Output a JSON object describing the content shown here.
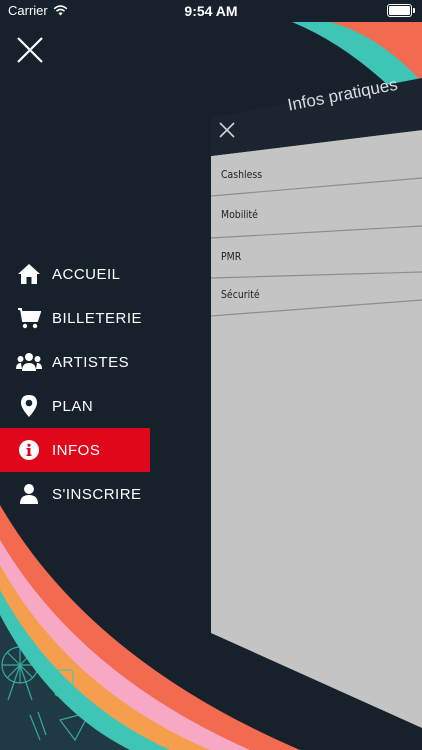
{
  "status": {
    "carrier": "Carrier",
    "time": "9:54 AM",
    "battery_level": 1.0
  },
  "menu": {
    "items": [
      {
        "label": "ACCUEIL",
        "icon": "home-icon",
        "active": false
      },
      {
        "label": "BILLETERIE",
        "icon": "cart-icon",
        "active": false
      },
      {
        "label": "ARTISTES",
        "icon": "users-icon",
        "active": false
      },
      {
        "label": "PLAN",
        "icon": "map-pin-icon",
        "active": false
      },
      {
        "label": "INFOS",
        "icon": "info-icon",
        "active": true
      },
      {
        "label": "S'INSCRIRE",
        "icon": "user-icon",
        "active": false
      }
    ]
  },
  "panel": {
    "title": "Infos pratiques",
    "rows": [
      {
        "label": "Cashless"
      },
      {
        "label": "Mobilité"
      },
      {
        "label": "PMR"
      },
      {
        "label": "Sécurité"
      }
    ]
  },
  "colors": {
    "background": "#17212b",
    "active": "#e0071b",
    "coral": "#f26a4f",
    "teal": "#3ec5b6",
    "pink": "#f7a8c4",
    "orange": "#f59f4e",
    "panel": "#c4c4c4"
  }
}
